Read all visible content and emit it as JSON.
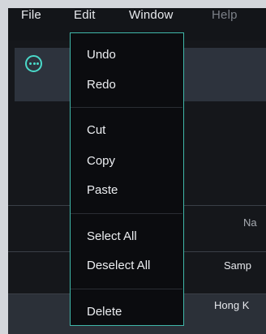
{
  "menubar": {
    "items": [
      {
        "label": "File",
        "enabled": true
      },
      {
        "label": "Edit",
        "enabled": true,
        "open": true
      },
      {
        "label": "Window",
        "enabled": true
      },
      {
        "label": "Help",
        "enabled": false
      }
    ]
  },
  "toolbar": {
    "more_icon": "ellipsis-circle-icon",
    "accent_color": "#4ad9c9"
  },
  "edit_menu": {
    "groups": [
      [
        {
          "label": "Undo"
        },
        {
          "label": "Redo"
        }
      ],
      [
        {
          "label": "Cut"
        },
        {
          "label": "Copy"
        },
        {
          "label": "Paste"
        }
      ],
      [
        {
          "label": "Select All"
        },
        {
          "label": "Deselect All"
        }
      ],
      [
        {
          "label": "Delete"
        }
      ]
    ]
  },
  "table": {
    "column_header": "Na",
    "rows": [
      {
        "cell": "Samp"
      },
      {
        "cell": "Hong K",
        "selected": true
      }
    ]
  }
}
